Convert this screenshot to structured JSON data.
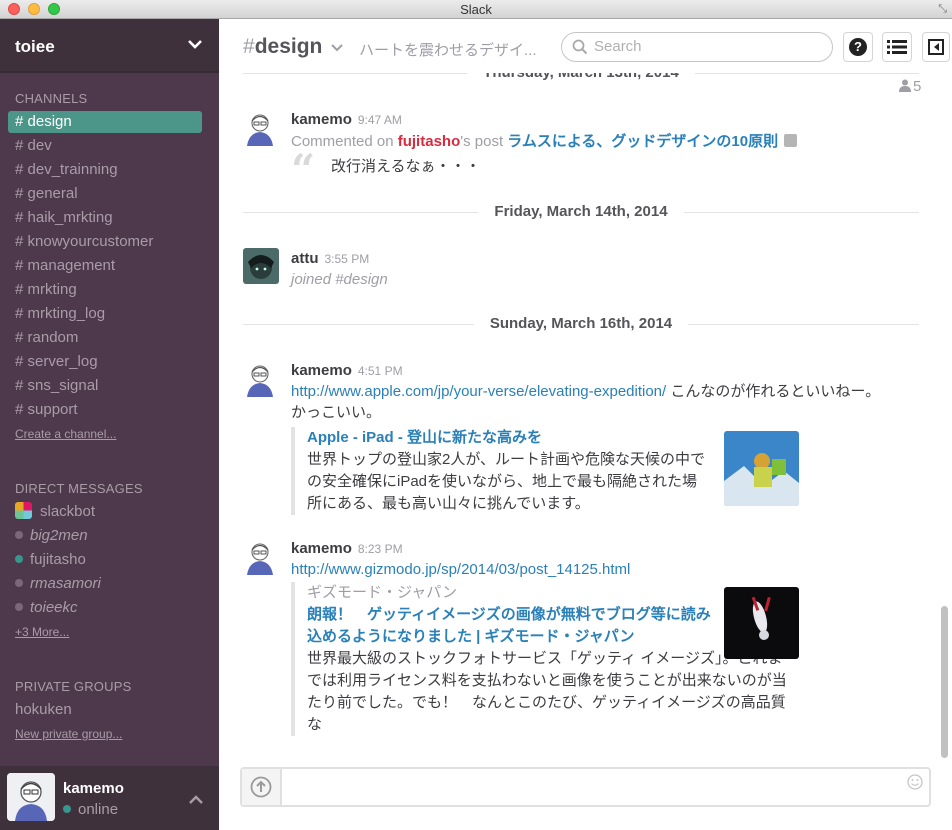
{
  "window": {
    "title": "Slack"
  },
  "team": {
    "name": "toiee"
  },
  "sidebar": {
    "channels_title": "CHANNELS",
    "channels": [
      {
        "label": "# design",
        "active": true
      },
      {
        "label": "# dev"
      },
      {
        "label": "# dev_trainning"
      },
      {
        "label": "# general"
      },
      {
        "label": "# haik_mrkting"
      },
      {
        "label": "# knowyourcustomer"
      },
      {
        "label": "# management"
      },
      {
        "label": "# mrkting"
      },
      {
        "label": "# mrkting_log"
      },
      {
        "label": "# random"
      },
      {
        "label": "# server_log"
      },
      {
        "label": "# sns_signal"
      },
      {
        "label": "# support"
      }
    ],
    "create_channel": "Create a channel...",
    "dm_title": "DIRECT MESSAGES",
    "dms": [
      {
        "label": "slackbot",
        "status": "bot"
      },
      {
        "label": "big2men",
        "status": "away"
      },
      {
        "label": "fujitasho",
        "status": "online"
      },
      {
        "label": "rmasamori",
        "status": "away"
      },
      {
        "label": "toieekc",
        "status": "away"
      }
    ],
    "more_dms": "+3 More...",
    "groups_title": "PRIVATE GROUPS",
    "groups": [
      {
        "label": "hokuken"
      }
    ],
    "new_group": "New private group..."
  },
  "user": {
    "name": "kamemo",
    "status": "online"
  },
  "header": {
    "hash": "#",
    "channel": "design",
    "purpose": "ハートを震わせるデザイ...",
    "search_placeholder": "Search",
    "help_label": "?",
    "member_count": "5"
  },
  "messages": {
    "divider0": "Thursday, March 13th, 2014",
    "m1": {
      "user": "kamemo",
      "time": "9:47 AM",
      "commented_on": "Commented on ",
      "mention": "fujitasho",
      "post_suffix": "'s post ",
      "post_title": "ラムスによる、グッドデザインの10原則",
      "comment": "改行消えるなぁ・・・"
    },
    "divider1": "Friday, March 14th, 2014",
    "m2": {
      "user": "attu",
      "time": "3:55 PM",
      "text": "joined #design"
    },
    "divider2": "Sunday, March 16th, 2014",
    "m3": {
      "user": "kamemo",
      "time": "4:51 PM",
      "link": "http://www.apple.com/jp/your-verse/elevating-expedition/",
      "text_after": " こんなのが作れるといいねー。",
      "text_line2": "かっこいい。",
      "att_title": "Apple - iPad - 登山に新たな高みを",
      "att_text": "世界トップの登山家2人が、ルート計画や危険な天候の中での安全確保にiPadを使いながら、地上で最も隔絶された場所にある、最も高い山々に挑んでいます。"
    },
    "m4": {
      "user": "kamemo",
      "time": "8:23 PM",
      "link": "http://www.gizmodo.jp/sp/2014/03/post_14125.html",
      "att_service": "ギズモード・ジャパン",
      "att_title": "朗報！　ゲッティイメージズの画像が無料でブログ等に読み込めるようになりました | ギズモード・ジャパン",
      "att_text": "世界最大級のストックフォトサービス「ゲッティ イメージズ」。これまでは利用ライセンス料を支払わないと画像を使うことが出来ないのが当たり前でした。でも！　なんとこのたび、ゲッティイメージズの高品質な"
    }
  },
  "composer": {
    "value": ""
  }
}
